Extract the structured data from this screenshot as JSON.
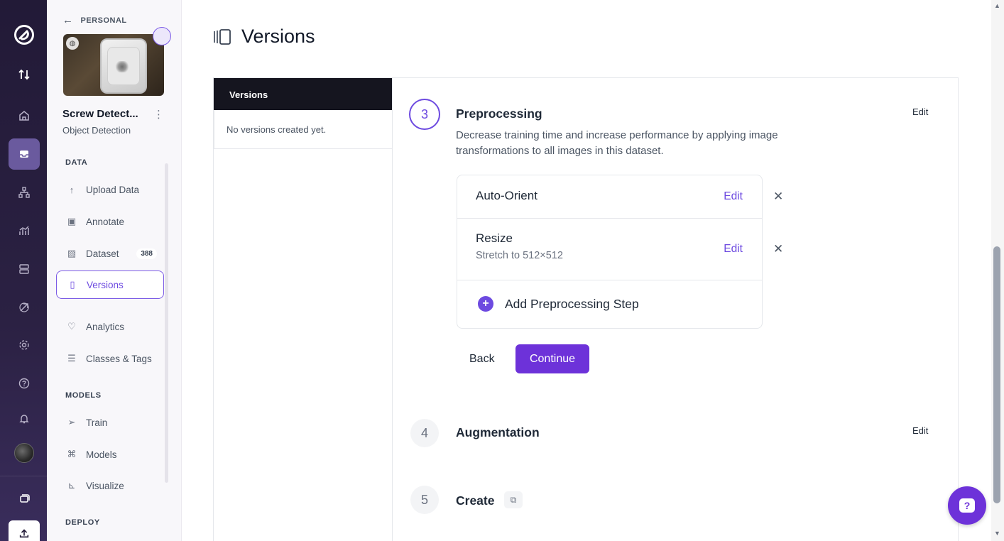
{
  "app": {
    "accent_color": "#6d32d9",
    "rail_icons": [
      "logo-icon",
      "swap-icon",
      "home-icon",
      "inbox-icon",
      "workflow-icon",
      "analytics-icon",
      "database-icon",
      "deploy-icon",
      "settings-icon",
      "help-icon",
      "bell-icon",
      "avatar",
      "stack-icon",
      "upload-icon"
    ]
  },
  "sidebar": {
    "back_label": "PERSONAL",
    "project_name": "Screw Detect...",
    "project_type": "Object Detection",
    "sections": {
      "data": "DATA",
      "models": "MODELS",
      "deploy": "DEPLOY"
    },
    "items": {
      "upload": "Upload Data",
      "annotate": "Annotate",
      "dataset": "Dataset",
      "dataset_count": "388",
      "versions": "Versions",
      "analytics": "Analytics",
      "classes": "Classes & Tags",
      "train": "Train",
      "models": "Models",
      "visualize": "Visualize"
    }
  },
  "main": {
    "title": "Versions",
    "versions_panel": {
      "header": "Versions",
      "empty_text": "No versions created yet."
    },
    "steps": {
      "preprocessing": {
        "number": "3",
        "title": "Preprocessing",
        "edit": "Edit",
        "description": "Decrease training time and increase performance by applying image transformations to all images in this dataset.",
        "items": [
          {
            "name": "Auto-Orient",
            "sub": "",
            "edit": "Edit"
          },
          {
            "name": "Resize",
            "sub": "Stretch to 512×512",
            "edit": "Edit"
          }
        ],
        "add_label": "Add Preprocessing Step",
        "back_label": "Back",
        "continue_label": "Continue"
      },
      "augmentation": {
        "number": "4",
        "title": "Augmentation",
        "edit": "Edit"
      },
      "create": {
        "number": "5",
        "title": "Create"
      }
    }
  },
  "help_button": {
    "icon": "help-chat-icon"
  }
}
